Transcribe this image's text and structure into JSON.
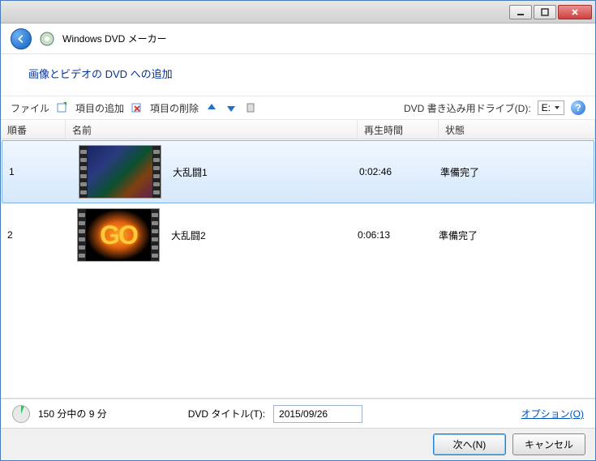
{
  "app": {
    "title": "Windows DVD メーカー"
  },
  "subheader": "画像とビデオの DVD への追加",
  "toolbar": {
    "file": "ファイル",
    "add_items": "項目の追加",
    "remove_items": "項目の削除",
    "drive_label": "DVD 書き込み用ドライブ(D):",
    "drive_value": "E:"
  },
  "columns": {
    "order": "順番",
    "name": "名前",
    "duration": "再生時間",
    "status": "状態"
  },
  "items": [
    {
      "order": "1",
      "name": "大乱闘1",
      "duration": "0:02:46",
      "status": "準備完了",
      "thumb_text": ""
    },
    {
      "order": "2",
      "name": "大乱闘2",
      "duration": "0:06:13",
      "status": "準備完了",
      "thumb_text": "GO"
    }
  ],
  "status": {
    "capacity": "150 分中の 9 分",
    "title_label": "DVD タイトル(T):",
    "title_value": "2015/09/26",
    "options_link": "オプション(O)"
  },
  "buttons": {
    "next": "次へ(N)",
    "cancel": "キャンセル"
  }
}
